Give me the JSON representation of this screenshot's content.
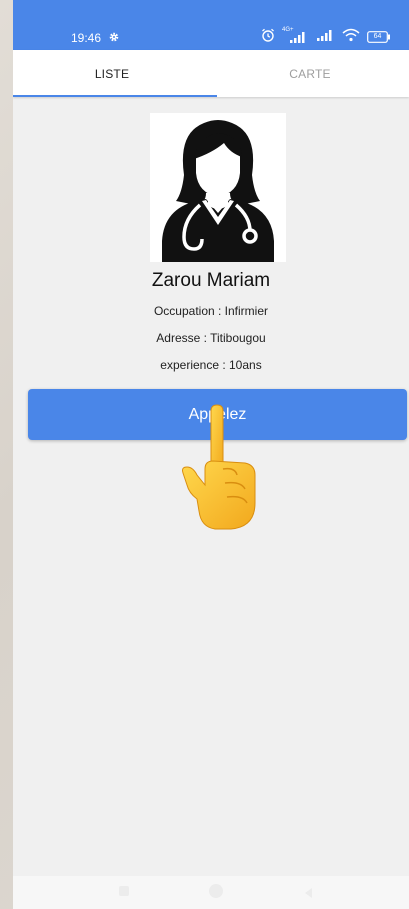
{
  "status_bar": {
    "time": "19:46",
    "network_label": "4G+",
    "battery": "64",
    "icons": [
      "gear-icon",
      "alarm-icon",
      "signal-icon",
      "signal-icon",
      "wifi-icon",
      "battery-icon"
    ],
    "color": "#4a86e8"
  },
  "tabs": [
    {
      "label": "LISTE",
      "active": true
    },
    {
      "label": "CARTE",
      "active": false
    }
  ],
  "profile": {
    "avatar_icon": "nurse-avatar-icon",
    "name": "Zarou Mariam",
    "occupation": "Occupation : Infirmier",
    "address": "Adresse : Titibougou",
    "experience": "experience : 10ans"
  },
  "call_button": {
    "label": "Appelez",
    "color": "#4a86e8"
  },
  "overlay": {
    "icon": "pointing-hand-icon"
  },
  "nav_bar": {
    "icons": [
      "recents-icon",
      "home-icon",
      "back-icon"
    ]
  },
  "colors": {
    "accent": "#4a86e8",
    "background": "#f0f0f0",
    "inactive_tab": "#9e9e9e"
  }
}
